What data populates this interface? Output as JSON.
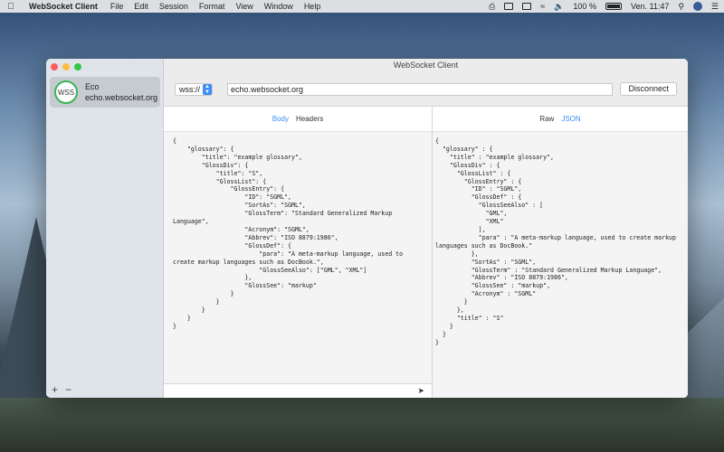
{
  "menubar": {
    "app_name": "WebSocket Client",
    "items": [
      "File",
      "Edit",
      "Session",
      "Format",
      "View",
      "Window",
      "Help"
    ],
    "battery": "100 %",
    "clock": "Ven. 11:47"
  },
  "window": {
    "title": "WebSocket Client"
  },
  "sidebar": {
    "connections": [
      {
        "badge": "WSS",
        "name": "Eco",
        "host": "echo.websocket.org"
      }
    ],
    "add_label": "+",
    "remove_label": "−"
  },
  "toolbar": {
    "protocol": "wss://",
    "url": "echo.websocket.org",
    "disconnect_label": "Disconnect"
  },
  "left_pane": {
    "tabs": [
      "Body",
      "Headers"
    ],
    "active_tab": "Body",
    "content": "{\n    \"glossary\": {\n        \"title\": \"example glossary\",\n        \"GlossDiv\": {\n            \"title\": \"S\",\n            \"GlossList\": {\n                \"GlossEntry\": {\n                    \"ID\": \"SGML\",\n                    \"SortAs\": \"SGML\",\n                    \"GlossTerm\": \"Standard Generalized Markup Language\",\n                    \"Acronym\": \"SGML\",\n                    \"Abbrev\": \"ISO 8879:1986\",\n                    \"GlossDef\": {\n                        \"para\": \"A meta-markup language, used to create markup languages such as DocBook.\",\n                        \"GlossSeeAlso\": [\"GML\", \"XML\"]\n                    },\n                    \"GlossSee\": \"markup\"\n                }\n            }\n        }\n    }\n}"
  },
  "right_pane": {
    "tabs": [
      "Raw",
      "JSON"
    ],
    "active_tab": "JSON",
    "content": "{\n  \"glossary\" : {\n    \"title\" : \"example glossary\",\n    \"GlossDiv\" : {\n      \"GlossList\" : {\n        \"GlossEntry\" : {\n          \"ID\" : \"SGML\",\n          \"GlossDef\" : {\n            \"GlossSeeAlso\" : [\n              \"GML\",\n              \"XML\"\n            ],\n            \"para\" : \"A meta-markup language, used to create markup languages such as DocBook.\"\n          },\n          \"SortAs\" : \"SGML\",\n          \"GlossTerm\" : \"Standard Generalized Markup Language\",\n          \"Abbrev\" : \"ISO 8879:1986\",\n          \"GlossSee\" : \"markup\",\n          \"Acronym\" : \"SGML\"\n        }\n      },\n      \"title\" : \"S\"\n    }\n  }\n}"
  },
  "composer": {
    "value": ""
  },
  "colors": {
    "accent": "#3d8ef7",
    "status_connected": "#3cb454"
  }
}
